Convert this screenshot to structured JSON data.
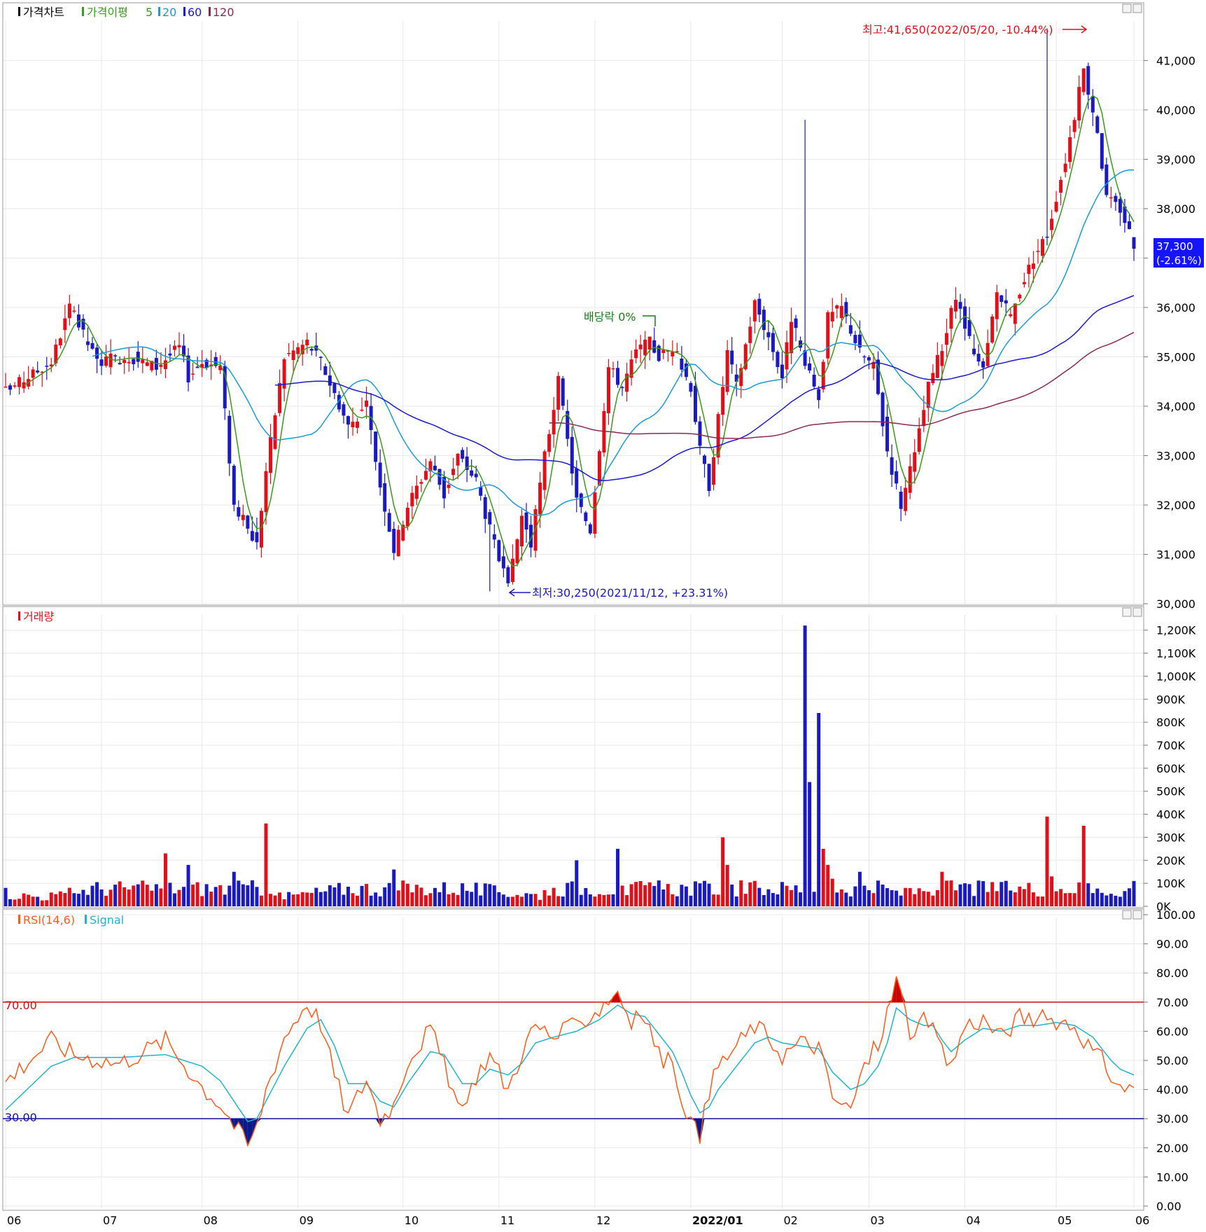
{
  "panels": {
    "price": {
      "title": "가격차트",
      "ma_label": "가격이평",
      "ma_periods": [
        "5",
        "20",
        "60",
        "120"
      ],
      "ma_colors": [
        "#3a9a1a",
        "#1a9ad8",
        "#1a1acc",
        "#8a2a50"
      ],
      "high_annotation": "최고:41,650(2022/05/20, -10.44%)",
      "low_annotation": "최저:30,250(2021/11/12, +23.31%)",
      "dividend_annotation": "배당락 0%",
      "current_price": "37,300",
      "current_change": "(-2.61%)",
      "y_ticks": [
        "30,000",
        "31,000",
        "32,000",
        "33,000",
        "34,000",
        "35,000",
        "36,000",
        "37,000",
        "38,000",
        "39,000",
        "40,000",
        "41,000"
      ]
    },
    "volume": {
      "title": "거래량",
      "y_ticks": [
        "0K",
        "100K",
        "200K",
        "300K",
        "400K",
        "500K",
        "600K",
        "700K",
        "800K",
        "900K",
        "1,000K",
        "1,100K",
        "1,200K"
      ]
    },
    "rsi": {
      "title": "RSI(14,6)",
      "signal_label": "Signal",
      "upper_line_label": "70.00",
      "lower_line_label": "30.00",
      "y_ticks": [
        "0.00",
        "10.00",
        "20.00",
        "30.00",
        "40.00",
        "50.00",
        "60.00",
        "70.00",
        "80.00",
        "90.00",
        "100.00"
      ]
    }
  },
  "x_labels": [
    "06",
    "07",
    "08",
    "09",
    "10",
    "11",
    "12",
    "2022/01",
    "02",
    "03",
    "04",
    "05",
    "06"
  ],
  "colors": {
    "up": "#e0101a",
    "down": "#1a1ac0",
    "rsi": "#ff5a1a",
    "signal": "#22b4cc",
    "upper": "#d01010",
    "lower": "#1010a0"
  },
  "chart_data": [
    {
      "type": "candlestick",
      "title": "가격차트",
      "x_range": [
        "2021-06",
        "2022-06"
      ],
      "ylim": [
        30000,
        41800
      ],
      "high": {
        "value": 41650,
        "date": "2022/05/20",
        "change": "-10.44%"
      },
      "low": {
        "value": 30250,
        "date": "2021/11/12",
        "change": "+23.31%"
      },
      "last_close": 37300,
      "last_change": "-2.61%",
      "moving_averages": [
        {
          "name": "5",
          "color": "#3a9a1a"
        },
        {
          "name": "20",
          "color": "#1a9ad8"
        },
        {
          "name": "60",
          "color": "#1a1acc"
        },
        {
          "name": "120",
          "color": "#8a2a50"
        }
      ],
      "anchors": {
        "x": [
          0,
          10,
          14,
          20,
          27,
          33,
          38,
          40,
          43,
          47,
          50,
          55,
          57,
          61,
          66,
          69,
          75,
          79,
          82,
          85,
          88,
          93,
          96,
          99,
          103,
          106,
          110,
          113,
          115,
          118,
          121,
          125,
          128,
          130,
          132,
          135,
          138,
          141,
          143,
          146,
          150,
          152,
          154,
          158,
          160,
          164,
          167,
          170,
          172,
          175,
          178,
          180,
          183,
          187,
          190,
          193,
          196,
          199,
          202,
          205,
          208,
          212,
          214,
          217,
          220,
          223,
          225,
          228,
          232,
          236,
          239,
          241,
          244,
          247
        ],
        "close": [
          34300,
          34900,
          36000,
          34900,
          35000,
          34800,
          35200,
          34600,
          34900,
          34800,
          32000,
          31200,
          32700,
          35000,
          35300,
          34900,
          33600,
          34000,
          32400,
          31100,
          32000,
          32900,
          32200,
          33000,
          32500,
          31500,
          30300,
          31800,
          31200,
          33000,
          34500,
          32100,
          31500,
          33200,
          34800,
          34400,
          35100,
          35300,
          35000,
          35200,
          34400,
          33100,
          32400,
          35100,
          34400,
          36100,
          35400,
          34600,
          35800,
          34800,
          34200,
          35800,
          36000,
          35100,
          34800,
          33100,
          32000,
          33000,
          34400,
          35200,
          36200,
          35000,
          34700,
          36300,
          35800,
          36600,
          37000,
          37500,
          39000,
          40800,
          39600,
          38200,
          38000,
          37300
        ]
      },
      "volume": {
        "ylim": [
          0,
          1260000
        ],
        "anchors": {
          "x": [
            0,
            10,
            35,
            40,
            50,
            57,
            60,
            85,
            118,
            125,
            134,
            135,
            157,
            158,
            175,
            176,
            178,
            179,
            180,
            181,
            187,
            197,
            205,
            228,
            229,
            236,
            237,
            247
          ],
          "values": [
            80000,
            60000,
            230000,
            180000,
            150000,
            360000,
            60000,
            160000,
            70000,
            200000,
            250000,
            90000,
            300000,
            180000,
            1220000,
            540000,
            840000,
            250000,
            180000,
            120000,
            150000,
            80000,
            150000,
            390000,
            130000,
            350000,
            100000,
            110000
          ]
        }
      },
      "rsi": {
        "ylim": [
          0,
          100
        ],
        "upper": 70,
        "lower": 30,
        "anchors": {
          "x": [
            0,
            10,
            15,
            25,
            35,
            43,
            47,
            50,
            53,
            55,
            57,
            61,
            66,
            69,
            72,
            75,
            79,
            82,
            85,
            88,
            93,
            96,
            100,
            103,
            106,
            110,
            113,
            116,
            120,
            125,
            130,
            134,
            137,
            140,
            143,
            146,
            148,
            150,
            152,
            154,
            156,
            160,
            164,
            167,
            170,
            174,
            178,
            181,
            185,
            188,
            191,
            193,
            195,
            198,
            201,
            203,
            205,
            207,
            210,
            214,
            218,
            222,
            226,
            230,
            234,
            238,
            240,
            242,
            244,
            247
          ],
          "rsi": [
            43,
            57,
            52,
            49,
            57,
            41,
            35,
            28,
            21,
            27,
            40,
            58,
            70,
            63,
            45,
            31,
            44,
            30,
            35,
            50,
            61,
            48,
            31,
            45,
            52,
            40,
            53,
            62,
            58,
            62,
            68,
            74,
            63,
            65,
            52,
            48,
            38,
            29,
            23,
            40,
            48,
            55,
            62,
            58,
            52,
            56,
            55,
            37,
            33,
            48,
            56,
            66,
            78,
            60,
            63,
            61,
            52,
            48,
            62,
            64,
            58,
            65,
            64,
            64,
            62,
            53,
            50,
            45,
            40,
            42
          ],
          "signal": [
            33,
            48,
            51,
            51,
            52,
            48,
            43,
            36,
            29,
            30,
            36,
            48,
            61,
            64,
            55,
            42,
            42,
            36,
            34,
            42,
            53,
            52,
            42,
            42,
            47,
            45,
            49,
            56,
            58,
            60,
            64,
            69,
            66,
            65,
            59,
            53,
            46,
            38,
            32,
            34,
            40,
            48,
            56,
            58,
            56,
            55,
            54,
            46,
            40,
            42,
            48,
            56,
            68,
            64,
            62,
            62,
            57,
            53,
            57,
            61,
            60,
            62,
            62,
            63,
            62,
            58,
            54,
            50,
            47,
            45
          ]
        }
      }
    }
  ]
}
